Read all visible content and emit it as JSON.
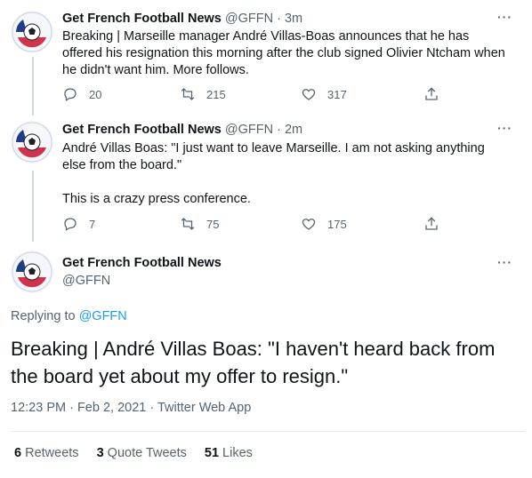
{
  "tweets": [
    {
      "name": "Get French Football News",
      "handle": "@GFFN",
      "time": "3m",
      "text": "Breaking | Marseille manager André Villas-Boas announces that he has offered his resignation this morning after the club signed Olivier Ntcham when he didn't want him. More follows.",
      "replies": "20",
      "retweets": "215",
      "likes": "317"
    },
    {
      "name": "Get French Football News",
      "handle": "@GFFN",
      "time": "2m",
      "text_line1": "André Villas Boas: \"I just want to leave Marseille. I am not asking anything else from the board.\"",
      "text_line2": "This is a crazy press conference.",
      "replies": "7",
      "retweets": "75",
      "likes": "175"
    }
  ],
  "main_tweet": {
    "name": "Get French Football News",
    "handle": "@GFFN",
    "replying_label": "Replying to",
    "replying_handle": "@GFFN",
    "text": "Breaking | André Villas Boas: \"I haven't heard back from the board yet about my offer to resign.\"",
    "timestamp": "12:23 PM · Feb 2, 2021 · Twitter Web App",
    "retweets_count": "6",
    "retweets_label": "Retweets",
    "quote_count": "3",
    "quote_label": "Quote Tweets",
    "likes_count": "51",
    "likes_label": "Likes"
  },
  "ui": {
    "more_glyph": "···",
    "separator": " · ",
    "accent": "#1d9bf0",
    "muted": "#536471",
    "icons": [
      "reply-icon",
      "retweet-icon",
      "like-icon",
      "share-icon",
      "more-icon",
      "avatar-logo"
    ]
  }
}
